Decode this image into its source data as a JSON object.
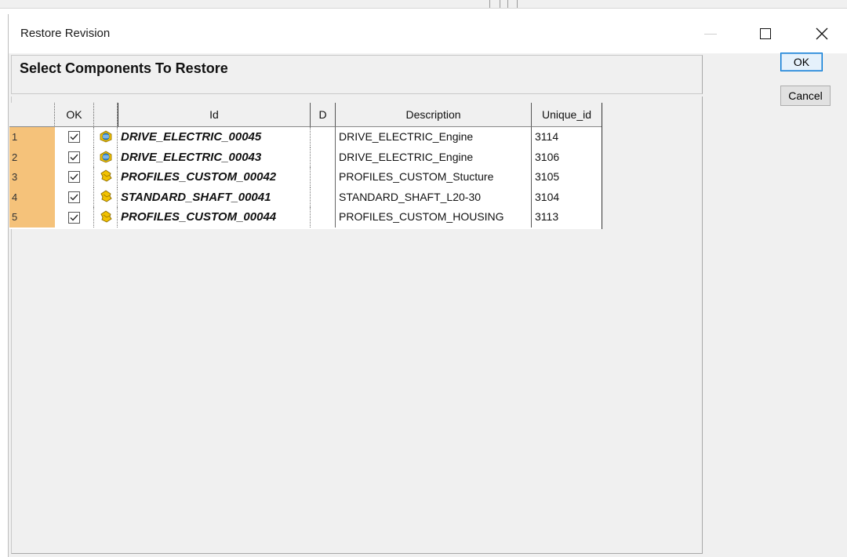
{
  "window": {
    "title": "Restore Revision",
    "close_glyph": "✕"
  },
  "panel": {
    "caption": "Select Components To Restore"
  },
  "buttons": {
    "ok": "OK",
    "cancel": "Cancel"
  },
  "table": {
    "headers": {
      "ok": "OK",
      "id": "Id",
      "d": "D",
      "description": "Description",
      "unique_id": "Unique_id"
    },
    "rows": [
      {
        "num": "1",
        "checked": true,
        "icon": "assembly-icon",
        "id": "DRIVE_ELECTRIC_00045",
        "d": "",
        "description": "DRIVE_ELECTRIC_Engine",
        "unique_id": "3114"
      },
      {
        "num": "2",
        "checked": true,
        "icon": "assembly-icon",
        "id": "DRIVE_ELECTRIC_00043",
        "d": "",
        "description": "DRIVE_ELECTRIC_Engine",
        "unique_id": "3106"
      },
      {
        "num": "3",
        "checked": true,
        "icon": "part-icon",
        "id": "PROFILES_CUSTOM_00042",
        "d": "",
        "description": "PROFILES_CUSTOM_Stucture",
        "unique_id": "3105"
      },
      {
        "num": "4",
        "checked": true,
        "icon": "part-icon",
        "id": "STANDARD_SHAFT_00041",
        "d": "",
        "description": "STANDARD_SHAFT_L20-30",
        "unique_id": "3104"
      },
      {
        "num": "5",
        "checked": true,
        "icon": "part-icon",
        "id": "PROFILES_CUSTOM_00044",
        "d": "",
        "description": "PROFILES_CUSTOM_HOUSING",
        "unique_id": "3113"
      }
    ]
  },
  "colors": {
    "row_number_bg": "#f5c27a",
    "ok_button_border": "#0078d7",
    "icon_yellow": "#f2c200",
    "icon_blue": "#3d8fd6"
  }
}
